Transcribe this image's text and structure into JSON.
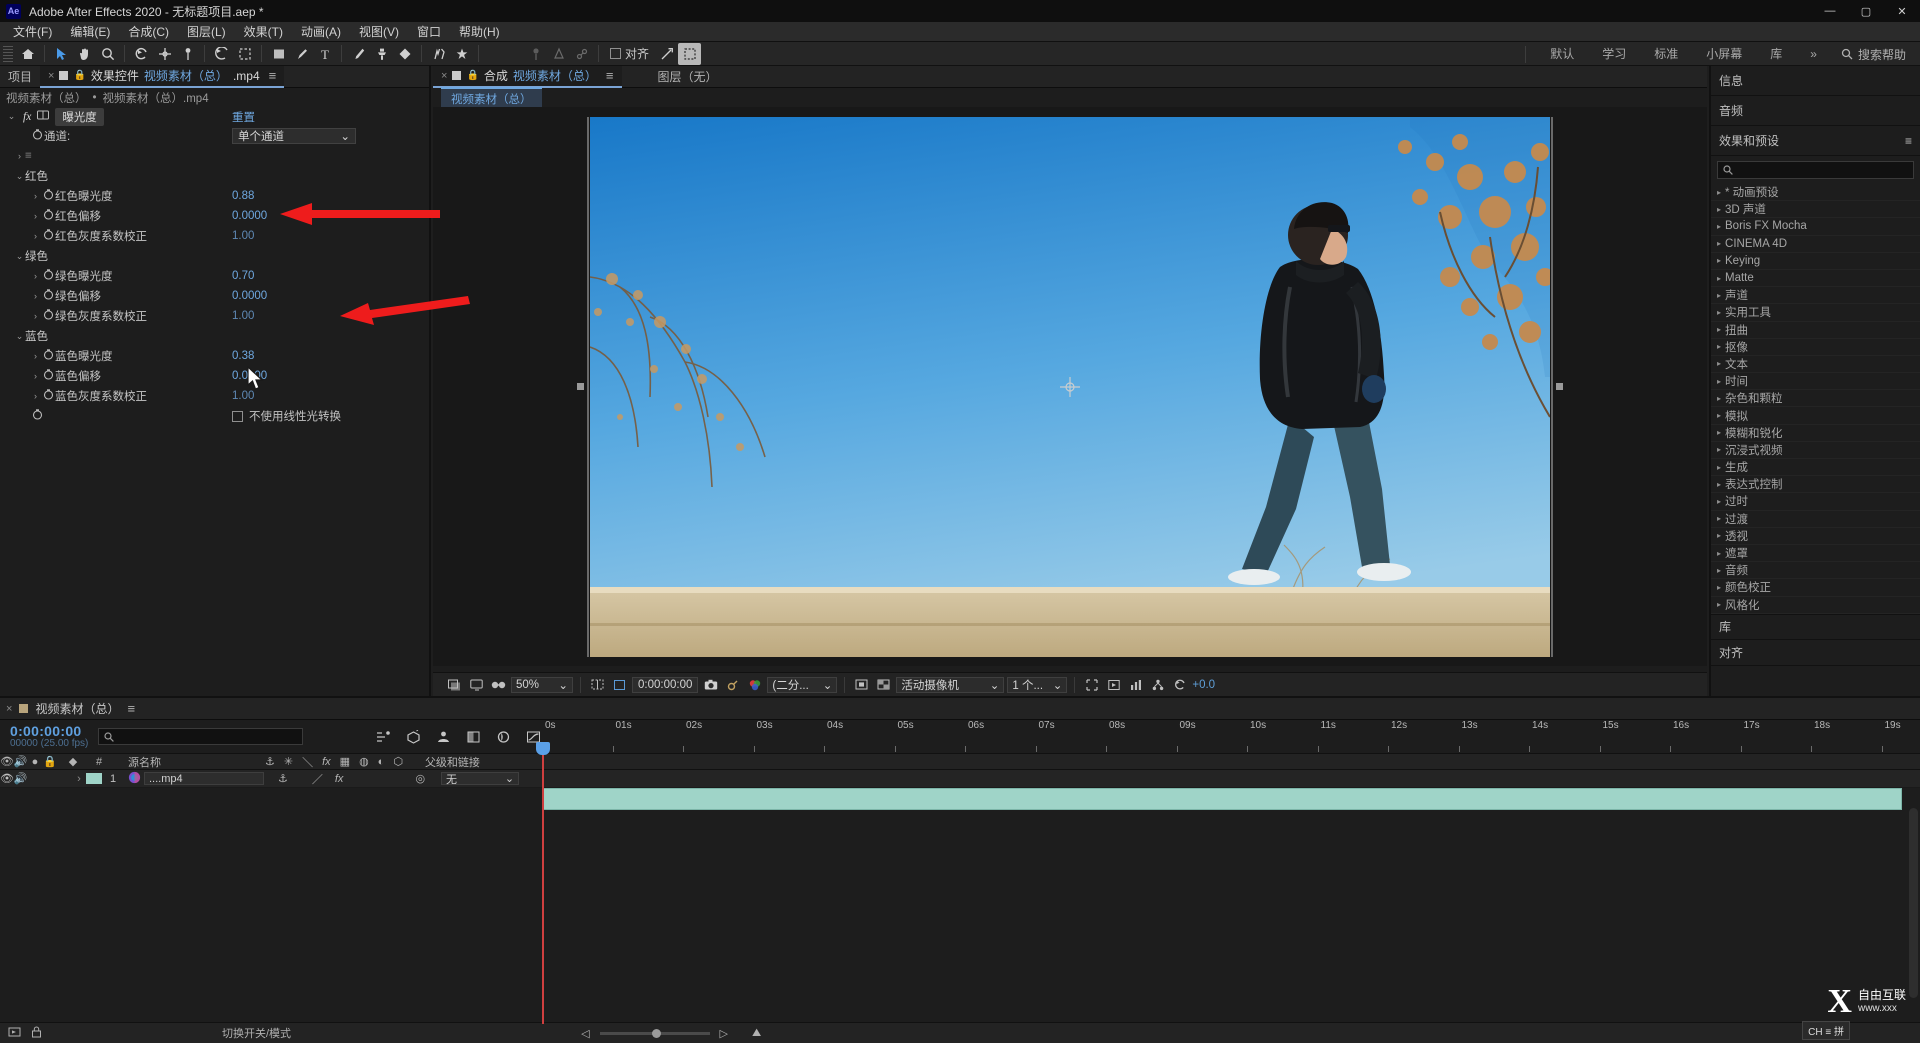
{
  "window": {
    "app_badge": "Ae",
    "title": "Adobe After Effects 2020 - 无标题项目.aep *",
    "minimize": "—",
    "maximize": "▢",
    "close": "✕"
  },
  "menubar": [
    "文件(F)",
    "编辑(E)",
    "合成(C)",
    "图层(L)",
    "效果(T)",
    "动画(A)",
    "视图(V)",
    "窗口",
    "帮助(H)"
  ],
  "toolbar": {
    "snap_label": "对齐",
    "workspaces": [
      "默认",
      "学习",
      "标准",
      "小屏幕",
      "库"
    ],
    "overflow": "»",
    "search_help": "搜索帮助"
  },
  "effect_controls": {
    "tabs": [
      {
        "label": "项目",
        "active": false
      },
      {
        "label": "效果控件 ",
        "file": "视频素材（总）",
        "suffix": ".mp4",
        "active": true
      }
    ],
    "breadcrumb_comp": "视频素材（总）",
    "breadcrumb_sep": "•",
    "breadcrumb_layer": "视频素材（总）.mp4",
    "effect_name": "曝光度",
    "reset_label": "重置",
    "channel_label": "通道:",
    "channel_value": "单个通道",
    "rows": [
      {
        "type": "group",
        "name": "红色"
      },
      {
        "type": "param",
        "name": "红色曝光度",
        "value": "0.88"
      },
      {
        "type": "param",
        "name": "红色偏移",
        "value": "0.0000"
      },
      {
        "type": "param",
        "name": "红色灰度系数校正",
        "value": "1.00"
      },
      {
        "type": "group",
        "name": "绿色"
      },
      {
        "type": "param",
        "name": "绿色曝光度",
        "value": "0.70"
      },
      {
        "type": "param",
        "name": "绿色偏移",
        "value": "0.0000"
      },
      {
        "type": "param",
        "name": "绿色灰度系数校正",
        "value": "1.00"
      },
      {
        "type": "group",
        "name": "蓝色"
      },
      {
        "type": "param",
        "name": "蓝色曝光度",
        "value": "0.38"
      },
      {
        "type": "param",
        "name": "蓝色偏移",
        "value": "0.0000"
      },
      {
        "type": "param",
        "name": "蓝色灰度系数校正",
        "value": "1.00"
      }
    ],
    "checkbox_row_label": "不使用线性光转换",
    "checkbox_checked": false
  },
  "composition": {
    "tabs": [
      {
        "label": "合成 ",
        "file": "视频素材（总）"
      },
      {
        "label": "图层（无）"
      }
    ],
    "subtab": "视频素材（总）",
    "viewer_bar": {
      "zoom": "50%",
      "timecode": "0:00:00:00",
      "resolution": "(二分...",
      "camera": "活动摄像机",
      "views": "1 个...",
      "exposure": "+0.0"
    }
  },
  "right_panels": {
    "info": "信息",
    "audio": "音频",
    "effects_presets": "效果和预设",
    "search_placeholder": "",
    "items": [
      "* 动画预设",
      "3D 声道",
      "Boris FX Mocha",
      "CINEMA 4D",
      "Keying",
      "Matte",
      "声道",
      "实用工具",
      "扭曲",
      "抠像",
      "文本",
      "时间",
      "杂色和颗粒",
      "模拟",
      "模糊和锐化",
      "沉浸式视频",
      "生成",
      "表达式控制",
      "过时",
      "过渡",
      "透视",
      "遮罩",
      "音频",
      "颜色校正",
      "风格化"
    ],
    "library": "库",
    "align": "对齐"
  },
  "timeline": {
    "tab_label": "视频素材（总）",
    "timecode": "0:00:00:00",
    "timecode_sub": "00000 (25.00 fps)",
    "search_placeholder": "",
    "columns": [
      "源名称",
      "父级和链接"
    ],
    "layer": {
      "index": "1",
      "name": "....mp4",
      "parent": "无"
    },
    "ruler_ticks": [
      "0s",
      "01s",
      "02s",
      "03s",
      "04s",
      "05s",
      "06s",
      "07s",
      "08s",
      "09s",
      "10s",
      "11s",
      "12s",
      "13s",
      "14s",
      "15s",
      "16s",
      "17s",
      "18s",
      "19s"
    ]
  },
  "statusbar": {
    "toggle_label": "切换开关/模式"
  },
  "watermark": {
    "mark": "X",
    "line1": "自由互联",
    "line2": "www.xxx"
  },
  "ime": "CH ≡ 拼",
  "colors": {
    "accent_blue": "#6fa8e0",
    "arrow_red": "#ee1c1c",
    "clip_teal": "#9fd4c8",
    "cti_red": "#cf3f3f"
  }
}
